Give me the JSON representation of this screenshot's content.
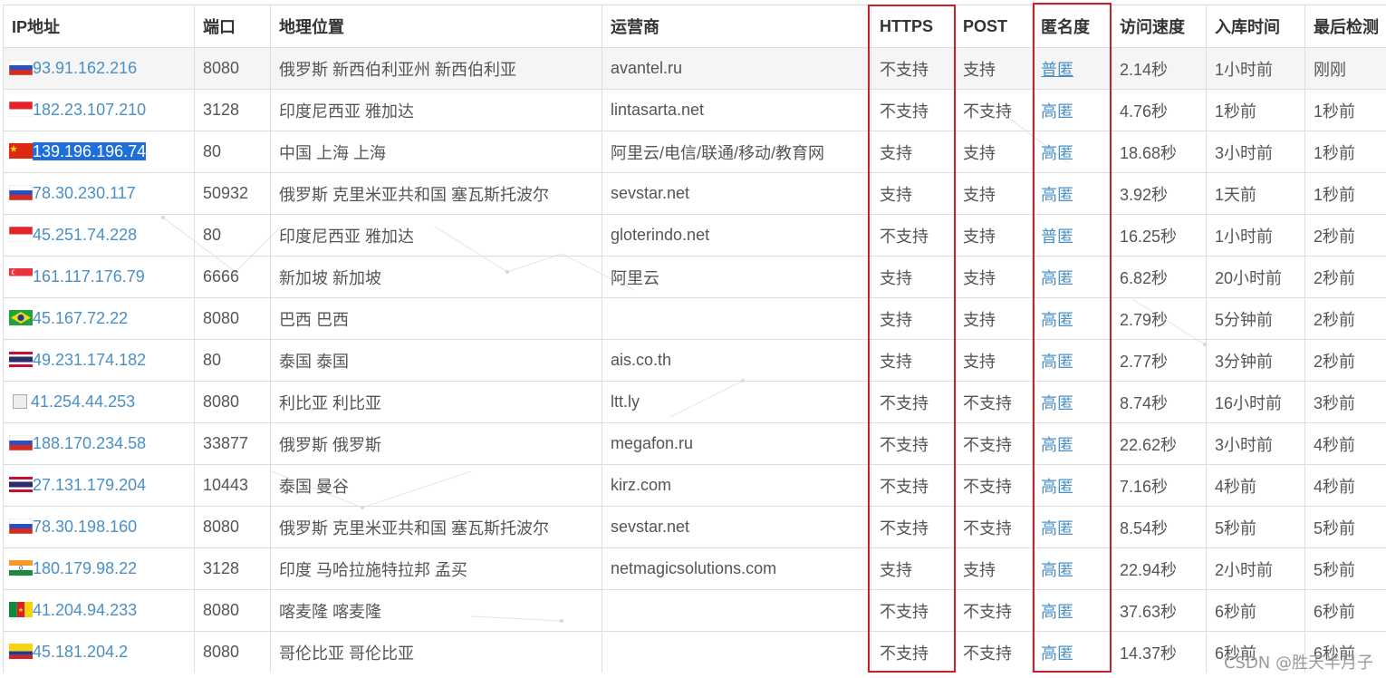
{
  "headers": [
    "IP地址",
    "端口",
    "地理位置",
    "运营商",
    "HTTPS",
    "POST",
    "匿名度",
    "访问速度",
    "入库时间",
    "最后检测"
  ],
  "rows": [
    {
      "flag": "ru",
      "ip": "93.91.162.216",
      "port": "8080",
      "geo": "俄罗斯 新西伯利亚州 新西伯利亚",
      "isp": "avantel.ru",
      "https": "不支持",
      "post": "支持",
      "anon": "普匿",
      "speed": "2.14秒",
      "added": "1小时前",
      "checked": "刚刚"
    },
    {
      "flag": "id",
      "ip": "182.23.107.210",
      "port": "3128",
      "geo": "印度尼西亚 雅加达",
      "isp": "lintasarta.net",
      "https": "不支持",
      "post": "不支持",
      "anon": "高匿",
      "speed": "4.76秒",
      "added": "1秒前",
      "checked": "1秒前"
    },
    {
      "flag": "cn",
      "ip": "139.196.196.74",
      "port": "80",
      "geo": "中国 上海 上海",
      "isp": "阿里云/电信/联通/移动/教育网",
      "https": "支持",
      "post": "支持",
      "anon": "高匿",
      "speed": "18.68秒",
      "added": "3小时前",
      "checked": "1秒前"
    },
    {
      "flag": "ru",
      "ip": "78.30.230.117",
      "port": "50932",
      "geo": "俄罗斯 克里米亚共和国 塞瓦斯托波尔",
      "isp": "sevstar.net",
      "https": "支持",
      "post": "支持",
      "anon": "高匿",
      "speed": "3.92秒",
      "added": "1天前",
      "checked": "1秒前"
    },
    {
      "flag": "id",
      "ip": "45.251.74.228",
      "port": "80",
      "geo": "印度尼西亚 雅加达",
      "isp": "gloterindo.net",
      "https": "不支持",
      "post": "支持",
      "anon": "普匿",
      "speed": "16.25秒",
      "added": "1小时前",
      "checked": "2秒前"
    },
    {
      "flag": "sg",
      "ip": "161.117.176.79",
      "port": "6666",
      "geo": "新加坡 新加坡",
      "isp": "阿里云",
      "https": "支持",
      "post": "支持",
      "anon": "高匿",
      "speed": "6.82秒",
      "added": "20小时前",
      "checked": "2秒前"
    },
    {
      "flag": "br",
      "ip": "45.167.72.22",
      "port": "8080",
      "geo": "巴西 巴西",
      "isp": "",
      "https": "支持",
      "post": "支持",
      "anon": "高匿",
      "speed": "2.79秒",
      "added": "5分钟前",
      "checked": "2秒前"
    },
    {
      "flag": "th",
      "ip": "49.231.174.182",
      "port": "80",
      "geo": "泰国 泰国",
      "isp": "ais.co.th",
      "https": "支持",
      "post": "支持",
      "anon": "高匿",
      "speed": "2.77秒",
      "added": "3分钟前",
      "checked": "2秒前"
    },
    {
      "flag": "broken",
      "ip": "41.254.44.253",
      "port": "8080",
      "geo": "利比亚 利比亚",
      "isp": "ltt.ly",
      "https": "不支持",
      "post": "不支持",
      "anon": "高匿",
      "speed": "8.74秒",
      "added": "16小时前",
      "checked": "3秒前"
    },
    {
      "flag": "ru",
      "ip": "188.170.234.58",
      "port": "33877",
      "geo": "俄罗斯 俄罗斯",
      "isp": "megafon.ru",
      "https": "不支持",
      "post": "不支持",
      "anon": "高匿",
      "speed": "22.62秒",
      "added": "3小时前",
      "checked": "4秒前"
    },
    {
      "flag": "th",
      "ip": "27.131.179.204",
      "port": "10443",
      "geo": "泰国 曼谷",
      "isp": "kirz.com",
      "https": "不支持",
      "post": "不支持",
      "anon": "高匿",
      "speed": "7.16秒",
      "added": "4秒前",
      "checked": "4秒前"
    },
    {
      "flag": "ru",
      "ip": "78.30.198.160",
      "port": "8080",
      "geo": "俄罗斯 克里米亚共和国 塞瓦斯托波尔",
      "isp": "sevstar.net",
      "https": "不支持",
      "post": "不支持",
      "anon": "高匿",
      "speed": "8.54秒",
      "added": "5秒前",
      "checked": "5秒前"
    },
    {
      "flag": "in",
      "ip": "180.179.98.22",
      "port": "3128",
      "geo": "印度 马哈拉施特拉邦 孟买",
      "isp": "netmagicsolutions.com",
      "https": "支持",
      "post": "支持",
      "anon": "高匿",
      "speed": "22.94秒",
      "added": "2小时前",
      "checked": "5秒前"
    },
    {
      "flag": "cm",
      "ip": "41.204.94.233",
      "port": "8080",
      "geo": "喀麦隆 喀麦隆",
      "isp": "",
      "https": "不支持",
      "post": "不支持",
      "anon": "高匿",
      "speed": "37.63秒",
      "added": "6秒前",
      "checked": "6秒前"
    },
    {
      "flag": "co",
      "ip": "45.181.204.2",
      "port": "8080",
      "geo": "哥伦比亚 哥伦比亚",
      "isp": "",
      "https": "不支持",
      "post": "不支持",
      "anon": "高匿",
      "speed": "14.37秒",
      "added": "6秒前",
      "checked": "6秒前"
    }
  ],
  "watermark": "CSDN @胜天半月子",
  "colors": {
    "link": "#4a8fc6",
    "highlight_box": "#c3242b",
    "selection": "#1e6fd9"
  }
}
